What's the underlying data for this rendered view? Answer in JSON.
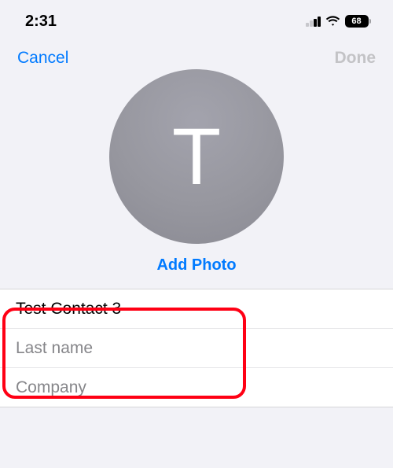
{
  "status": {
    "time": "2:31",
    "battery_pct": "68"
  },
  "nav": {
    "cancel": "Cancel",
    "done": "Done"
  },
  "avatar": {
    "letter": "T",
    "add_photo": "Add Photo"
  },
  "form": {
    "first_name_value": "Test Contact 3",
    "last_name_placeholder": "Last name",
    "company_placeholder": "Company"
  }
}
